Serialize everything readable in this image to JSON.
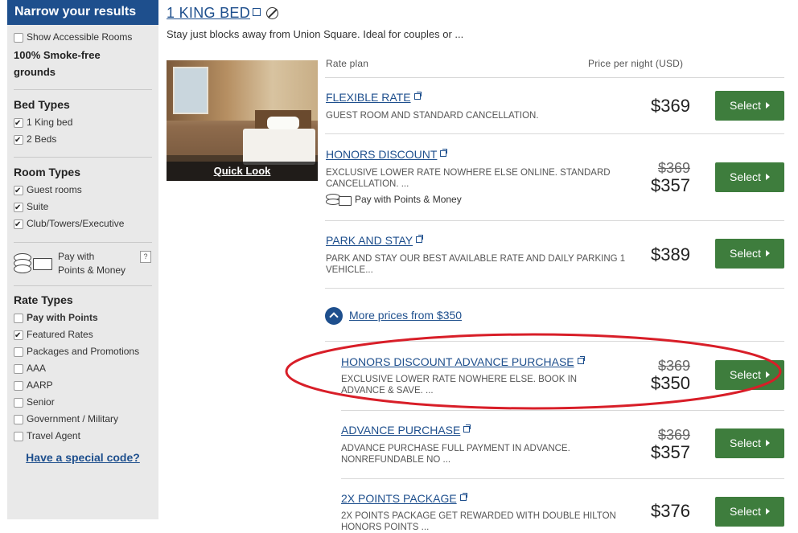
{
  "sidebar": {
    "header": "Narrow your results",
    "accessible": {
      "label": "Show Accessible Rooms",
      "checked": false
    },
    "smoke_free": "100% Smoke-free grounds",
    "bed_types": {
      "title": "Bed Types",
      "items": [
        {
          "label": "1 King bed",
          "checked": true
        },
        {
          "label": "2 Beds",
          "checked": true
        }
      ]
    },
    "room_types": {
      "title": "Room Types",
      "items": [
        {
          "label": "Guest rooms",
          "checked": true
        },
        {
          "label": "Suite",
          "checked": true
        },
        {
          "label": "Club/Towers/Executive",
          "checked": true
        }
      ]
    },
    "points_money": {
      "label_line1": "Pay with",
      "label_line2": "Points & Money",
      "help": "?"
    },
    "rate_types": {
      "title": "Rate Types",
      "items": [
        {
          "label": "Pay with Points",
          "checked": false,
          "bold": true
        },
        {
          "label": "Featured Rates",
          "checked": true
        },
        {
          "label": "Packages and Promotions",
          "checked": false
        },
        {
          "label": "AAA",
          "checked": false
        },
        {
          "label": "AARP",
          "checked": false
        },
        {
          "label": "Senior",
          "checked": false
        },
        {
          "label": "Government / Military",
          "checked": false
        },
        {
          "label": "Travel Agent",
          "checked": false
        }
      ]
    },
    "special_code": "Have a special code?"
  },
  "room": {
    "title": "1 KING BED",
    "description": "Stay just blocks away from Union Square. Ideal for couples or ...",
    "quick_look": "Quick Look",
    "col_rate_plan": "Rate plan",
    "col_price": "Price per night (USD)"
  },
  "rates": [
    {
      "name": "FLEXIBLE RATE",
      "desc": "GUEST ROOM AND STANDARD CANCELLATION.",
      "old_price": "",
      "price": "$369",
      "button": "Select"
    },
    {
      "name": "HONORS DISCOUNT",
      "desc": "EXCLUSIVE LOWER RATE NOWHERE ELSE ONLINE. STANDARD CANCELLATION. ...",
      "extra": "Pay with Points & Money",
      "old_price": "$369",
      "price": "$357",
      "button": "Select"
    },
    {
      "name": "PARK AND STAY",
      "desc": "PARK AND STAY OUR BEST AVAILABLE RATE AND DAILY PARKING 1 VEHICLE...",
      "old_price": "",
      "price": "$389",
      "button": "Select"
    }
  ],
  "more_prices": "More prices from $350",
  "more_rates": [
    {
      "name": "HONORS DISCOUNT ADVANCE PURCHASE",
      "desc": "EXCLUSIVE LOWER RATE NOWHERE ELSE. BOOK IN ADVANCE & SAVE. ...",
      "old_price": "$369",
      "price": "$350",
      "button": "Select"
    },
    {
      "name": "ADVANCE PURCHASE",
      "desc": "ADVANCE PURCHASE FULL PAYMENT IN ADVANCE. NONREFUNDABLE NO ...",
      "old_price": "$369",
      "price": "$357",
      "button": "Select"
    },
    {
      "name": "2X POINTS PACKAGE",
      "desc": "2X POINTS PACKAGE GET REWARDED WITH DOUBLE HILTON HONORS POINTS ...",
      "old_price": "",
      "price": "$376",
      "button": "Select"
    }
  ],
  "colors": {
    "brand_blue": "#1e4f8d",
    "select_green": "#3e7d3d",
    "highlight_red": "#d81e28"
  }
}
